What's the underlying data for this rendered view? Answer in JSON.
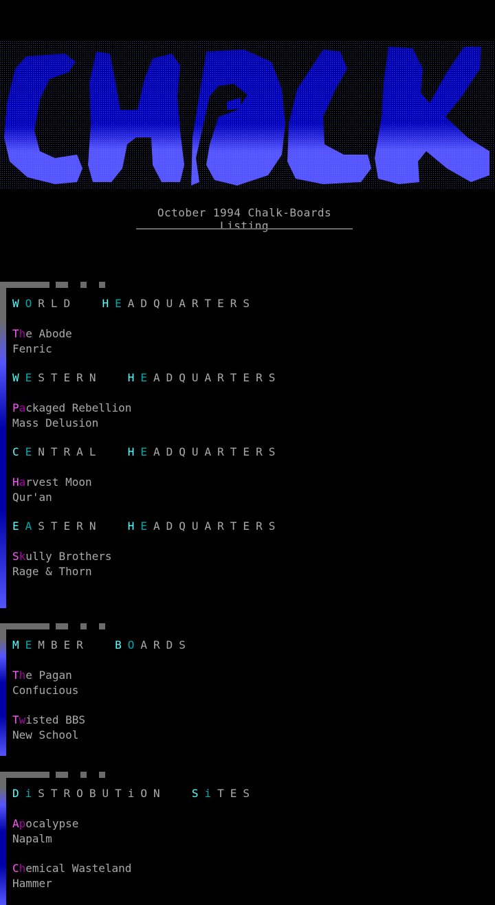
{
  "logo": {
    "alt_text": "CHALK"
  },
  "subtitle": "October 1994 Chalk-Boards Listing",
  "colors": {
    "background": "#000000",
    "logo_dark": "#0000aa",
    "logo_light": "#5555ff",
    "heading_cyan": "#55ffff",
    "heading_teal": "#00aaaa",
    "name_magenta": "#ff55ff",
    "name_purple": "#aa00aa",
    "text_gray": "#aaaaaa",
    "frame_gray": "#6b6b6b"
  },
  "sections": [
    {
      "groups": [
        {
          "heading": [
            "W",
            "O",
            "RLD",
            "H",
            "E",
            "ADQUARTERS"
          ],
          "boards": [
            {
              "name": [
                "T",
                "h",
                "e Abode"
              ],
              "sysop": "Fenric"
            }
          ]
        },
        {
          "heading": [
            "W",
            "E",
            "STERN",
            "H",
            "E",
            "ADQUARTERS"
          ],
          "boards": [
            {
              "name": [
                "P",
                "a",
                "ckaged Rebellion"
              ],
              "sysop": "Mass Delusion"
            }
          ]
        },
        {
          "heading": [
            "C",
            "E",
            "NTRAL",
            "H",
            "E",
            "ADQUARTERS"
          ],
          "boards": [
            {
              "name": [
                "H",
                "a",
                "rvest Moon"
              ],
              "sysop": "Qur'an"
            }
          ]
        },
        {
          "heading": [
            "E",
            "A",
            "STERN",
            "H",
            "E",
            "ADQUARTERS"
          ],
          "boards": [
            {
              "name": [
                "S",
                "k",
                "ully Brothers"
              ],
              "sysop": "Rage & Thorn"
            }
          ]
        }
      ]
    },
    {
      "groups": [
        {
          "heading": [
            "M",
            "E",
            "MBER",
            "B",
            "O",
            "ARDS"
          ],
          "boards": [
            {
              "name": [
                "T",
                "h",
                "e Pagan"
              ],
              "sysop": "Confucious"
            },
            {
              "name": [
                "T",
                "w",
                "isted BBS"
              ],
              "sysop": "New School"
            }
          ]
        }
      ]
    },
    {
      "groups": [
        {
          "heading": [
            "D",
            "i",
            "STROBUTiON",
            "S",
            "i",
            "TES"
          ],
          "boards": [
            {
              "name": [
                "A",
                "p",
                "ocalypse"
              ],
              "sysop": "Napalm"
            },
            {
              "name": [
                "C",
                "h",
                "emical Wasteland"
              ],
              "sysop": "Hammer"
            }
          ]
        }
      ]
    }
  ]
}
